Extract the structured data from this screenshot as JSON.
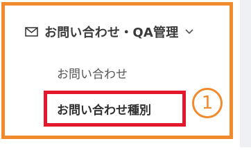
{
  "menu": {
    "header": {
      "icon": "mail-icon",
      "title": "お問い合わせ・QA管理",
      "expand_icon": "chevron-down-icon"
    },
    "items": [
      {
        "label": "お問い合わせ",
        "active": false
      },
      {
        "label": "お問い合わせ種別",
        "active": true
      }
    ]
  },
  "annotation": {
    "step_number": "1",
    "highlight_color": "#e3182d",
    "frame_color": "#f08a2c"
  }
}
